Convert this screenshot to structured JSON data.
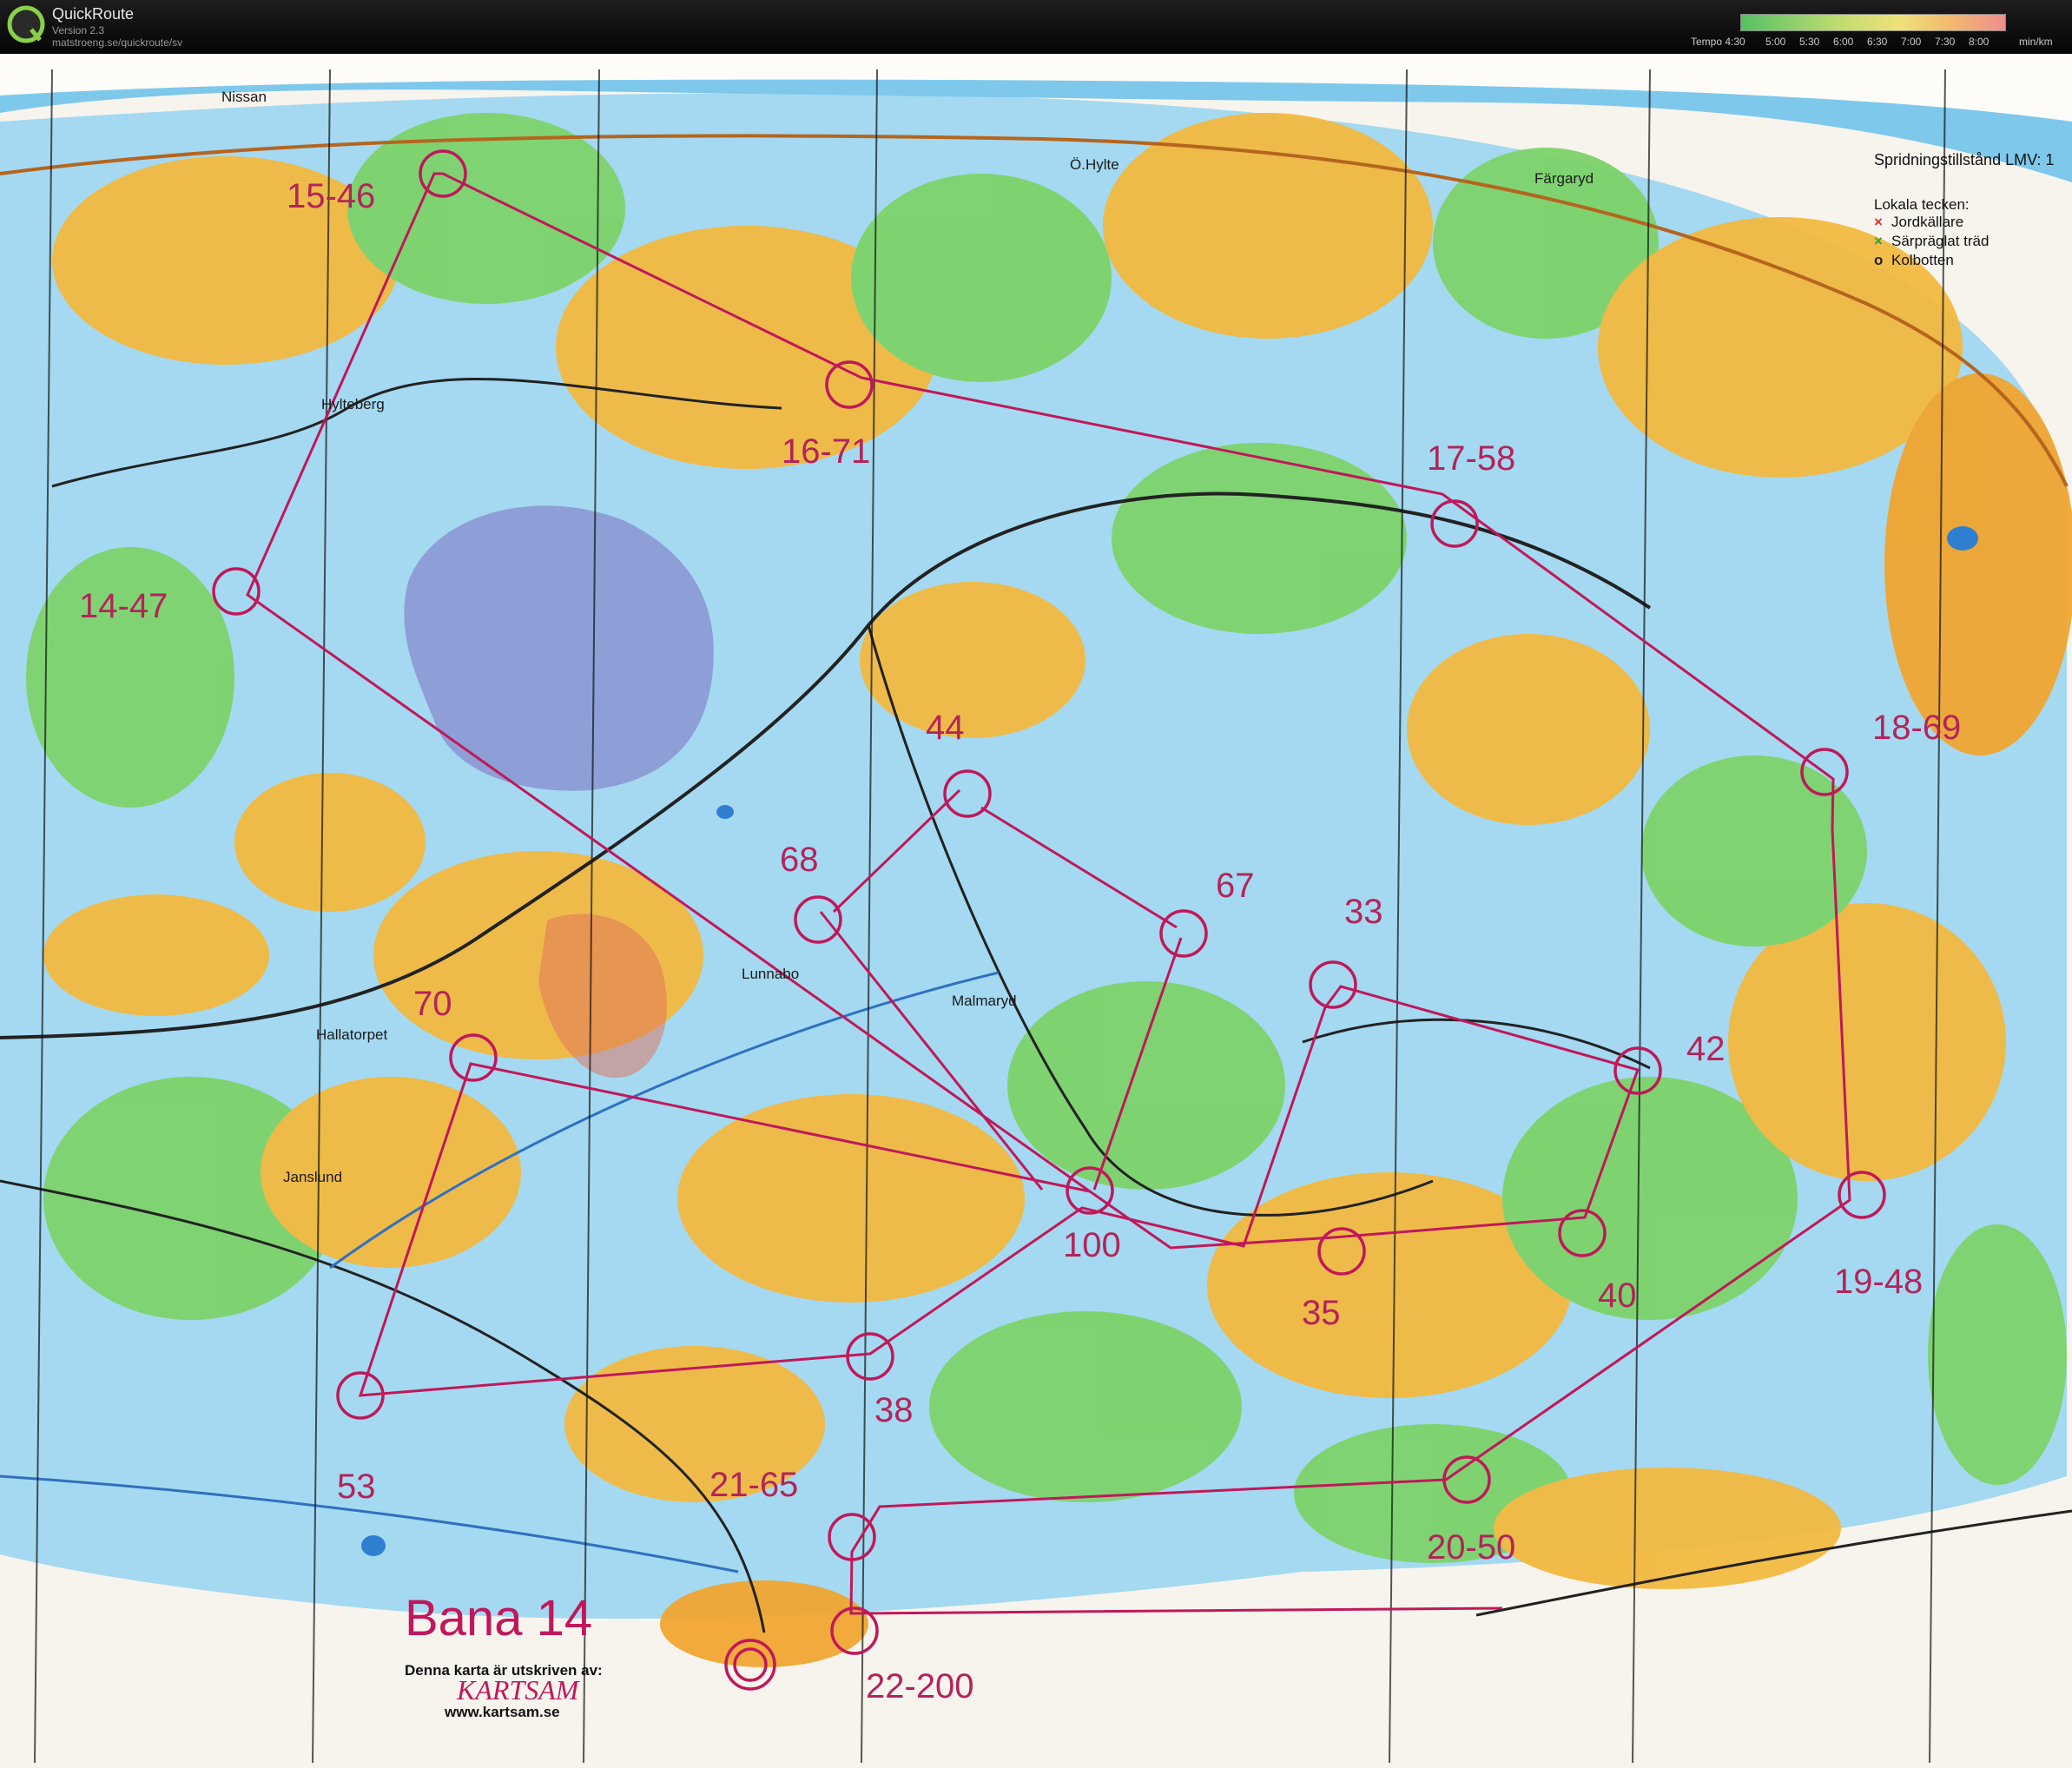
{
  "app": {
    "title": "QuickRoute",
    "version": "Version 2.3",
    "url": "matstroeng.se/quickroute/sv"
  },
  "tempo": {
    "label": "Tempo 4:30",
    "ticks": [
      "5:00",
      "5:30",
      "6:00",
      "6:30",
      "7:00",
      "7:30",
      "8:00"
    ],
    "unit": "min/km"
  },
  "map": {
    "places": [
      "Nissan",
      "Ö.Hylte",
      "Färgaryd",
      "Hylteberg",
      "Lunnabo",
      "Malmaryd",
      "Hallatorpet",
      "Janslund"
    ],
    "course_title": "Bana 14",
    "printed_by": "Denna karta är utskriven av:",
    "printer_logo": "KARTSAM",
    "printer_url": "www.kartsam.se",
    "colors": {
      "course": "#c0185a",
      "open_land": "#f3b53b",
      "forest_green": "#6cc95a",
      "marsh_blue": "#8fd0ee",
      "restricted": "#7b6ec0"
    }
  },
  "legend": {
    "heading": "Spridningstillstånd LMV: 1",
    "local_heading": "Lokala tecken:",
    "items": [
      {
        "label": "Jordkällare",
        "symbol": "×",
        "color": "#d8342c"
      },
      {
        "label": "Särpräglat träd",
        "symbol": "×",
        "color": "#2ea33a"
      },
      {
        "label": "Kolbotten",
        "symbol": "o",
        "color": "#222222"
      }
    ]
  },
  "course": {
    "controls": [
      {
        "label": "15-46"
      },
      {
        "label": "16-71"
      },
      {
        "label": "17-58"
      },
      {
        "label": "18-69"
      },
      {
        "label": "19-48"
      },
      {
        "label": "20-50"
      },
      {
        "label": "21-65"
      },
      {
        "label": "22-200"
      },
      {
        "label": "14-47"
      },
      {
        "label": "44"
      },
      {
        "label": "68"
      },
      {
        "label": "67"
      },
      {
        "label": "33"
      },
      {
        "label": "42"
      },
      {
        "label": "70"
      },
      {
        "label": "100"
      },
      {
        "label": "35"
      },
      {
        "label": "40"
      },
      {
        "label": "38"
      },
      {
        "label": "53"
      }
    ]
  }
}
